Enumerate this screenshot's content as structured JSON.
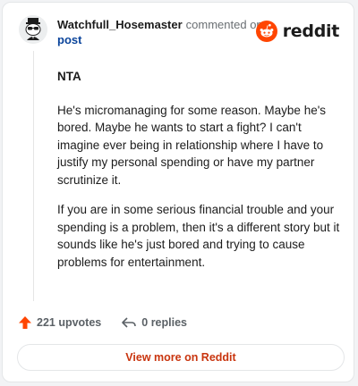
{
  "header": {
    "author": "Watchfull_Hosemaster",
    "action": "commented on",
    "post_link": "post",
    "logo_text": "reddit"
  },
  "comment": {
    "title": "NTA",
    "paragraphs": [
      "He's micromanaging for some reason. Maybe he's bored. Maybe he wants to start a fight? I can't imagine ever being in relationship where I have to justify my personal spending or have my partner scrutinize it.",
      "If you are in some serious financial trouble and your spending is a problem, then it's a different story but it sounds like he's just bored and trying to cause problems for entertainment."
    ]
  },
  "footer": {
    "upvotes": "221 upvotes",
    "replies": "0 replies"
  },
  "view_more": {
    "label": "View more on Reddit"
  },
  "colors": {
    "reddit_orange": "#ff4500",
    "link_blue": "#0a449b",
    "view_more_text": "#c9350f",
    "meta_gray": "#5b6166"
  },
  "icons": {
    "avatar": "snoo-avatar-icon",
    "logo": "reddit-logo-icon",
    "upvote": "upvote-arrow-icon",
    "reply": "reply-arrow-icon"
  }
}
